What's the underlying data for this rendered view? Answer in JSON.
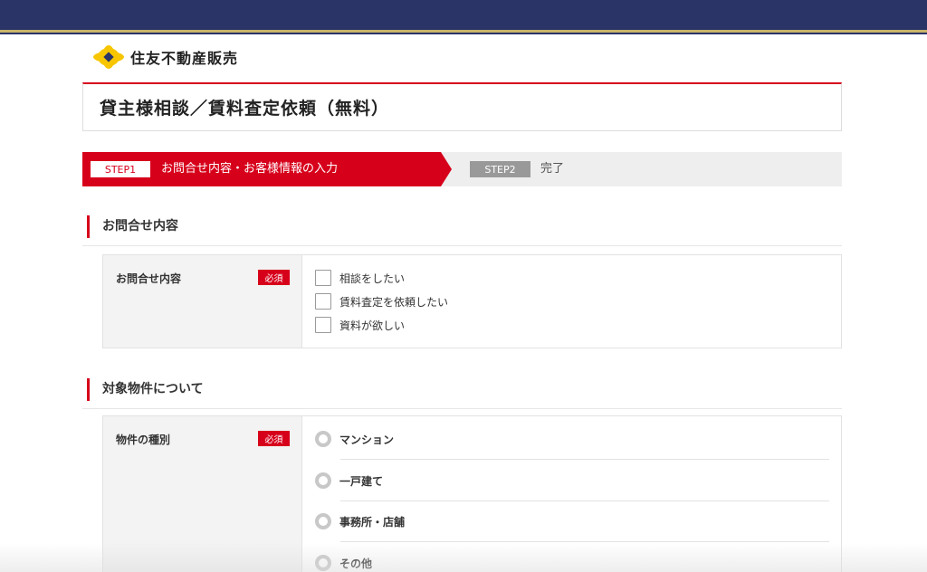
{
  "header": {
    "logo_text": "住友不動産販売",
    "colors": {
      "bar": "#2a3467",
      "accent_line": "#c9b56a",
      "brand_red": "#d7001b",
      "logo_yellow": "#f7c600"
    }
  },
  "page": {
    "title": "貸主様相談／賃料査定依頼（無料）"
  },
  "steps": {
    "step1_badge": "STEP1",
    "step1_label": "お問合せ内容・お客様情報の入力",
    "step2_badge": "STEP2",
    "step2_label": "完了"
  },
  "section_inquiry": {
    "heading": "お問合せ内容",
    "field_label": "お問合せ内容",
    "required_badge": "必須",
    "options": [
      "相談をしたい",
      "賃料査定を依頼したい",
      "資料が欲しい"
    ]
  },
  "section_property": {
    "heading": "対象物件について",
    "field_label": "物件の種別",
    "required_badge": "必須",
    "options": [
      "マンション",
      "一戸建て",
      "事務所・店舗",
      "その他"
    ]
  }
}
